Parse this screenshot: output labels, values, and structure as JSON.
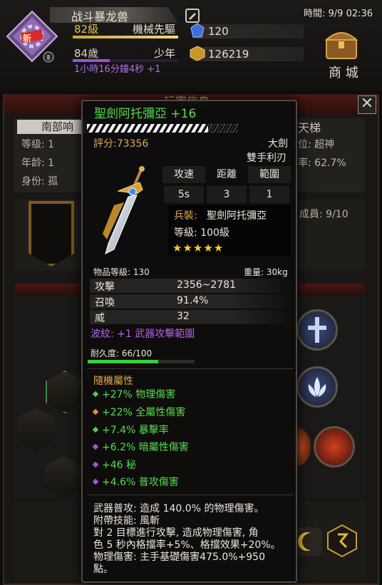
{
  "hud": {
    "name": "战斗暴龙兽",
    "badge": "新",
    "level": "82級",
    "class": "機械先驅",
    "age": "84歲",
    "age_title": "少年",
    "age_timer": "1小時16分鐘4秒 +1",
    "gems": "120",
    "gold": "126219",
    "time": "時間: 9/9 02:36",
    "shop": "商 城",
    "level_progress": 1.0,
    "age_progress": 0.35
  },
  "background": {
    "title": "玩家信息",
    "tab_left": "南部响",
    "tianti": "天梯",
    "left_rows": [
      "等级: 1",
      "年龄: 1",
      "身份: 孤"
    ],
    "right_rows": [
      "位: 超神",
      "率: 62.7%"
    ],
    "members": "成員: 9/10",
    "close": "✕"
  },
  "tooltip": {
    "item_name": "聖劍阿托彌亞 +16",
    "score": "評分:73356",
    "weapon_type": "大劍",
    "handedness": "雙手利刃",
    "stat_headers": [
      "攻速",
      "距離",
      "範圍"
    ],
    "stat_values": [
      "5s",
      "3",
      "1"
    ],
    "weapon_label": "兵裝:",
    "weapon_name": "聖劍阿托彌亞",
    "weapon_grade": "等級: 100級",
    "stars": "★★★★★",
    "item_level": "物品等級: 130",
    "weight": "重量: 30kg",
    "stats": [
      {
        "label": "攻擊",
        "value": "2356~2781"
      },
      {
        "label": "召喚",
        "value": "91.4%"
      },
      {
        "label": "威",
        "value": "32"
      }
    ],
    "ripple": "波紋: +1 武器攻擊範圍",
    "durability": "耐久度: 66/100",
    "durability_ratio": 0.66,
    "random_title": "隨機屬性",
    "random_attrs": [
      {
        "text": "+27% 物理傷害",
        "bullet": "green"
      },
      {
        "text": "+22% 全屬性傷害",
        "bullet": "orange"
      },
      {
        "text": "+7.4% 暴擊率",
        "bullet": "green"
      },
      {
        "text": "+6.2% 暗屬性傷害",
        "bullet": "purple"
      },
      {
        "text": "+46 秘",
        "bullet": "purple"
      },
      {
        "text": "+4.6% 普攻傷害",
        "bullet": "purple"
      }
    ],
    "description": [
      "武器普攻: 造成 140.0% 的物理傷害。",
      "附帶技能: 風斬",
      "對 2 目標進行攻擊, 造成物理傷害, 角",
      "色 5 秒內格擋率+5%、格擋效果+20%。",
      "物理傷害: 主手基礎傷害475.0%+950",
      "點。"
    ]
  },
  "colors": {
    "name_green": "#4fdc4a",
    "orange": "#e2a94a",
    "purple": "#b860e8",
    "star": "#ffcb3a"
  }
}
